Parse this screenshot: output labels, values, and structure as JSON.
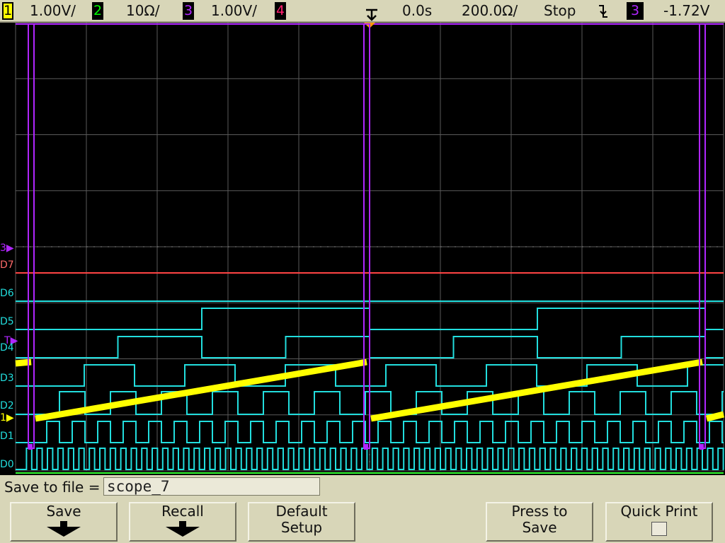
{
  "status_bar": {
    "ch1": {
      "num": "1",
      "scale": "1.00V/",
      "color": "#ffff00"
    },
    "ch2": {
      "num": "2",
      "scale": "10Ω/",
      "color": "#00ff00"
    },
    "ch3": {
      "num": "3",
      "scale": "1.00V/",
      "color": "#b026ff"
    },
    "ch4": {
      "num": "4",
      "color": "#ff1f6e"
    },
    "trigger_delay": "0.0s",
    "timebase": "200.0Ω/",
    "run_state": "Stop",
    "trigger_source": "3",
    "trigger_level": "-1.72V"
  },
  "channel_labels": {
    "ch3": "3",
    "d7": "D7",
    "d6": "D6",
    "d5": "D5",
    "t": "T",
    "d4": "D4",
    "d3": "D3",
    "d2": "D2",
    "ch1": "1",
    "d1": "D1",
    "d0": "D0"
  },
  "save_bar": {
    "label": "Save to file =",
    "filename": "scope_7"
  },
  "softkeys": {
    "save": "Save",
    "recall": "Recall",
    "default_setup_1": "Default",
    "default_setup_2": "Setup",
    "press_to_save_1": "Press to",
    "press_to_save_2": "Save",
    "quick_print": "Quick Print"
  },
  "colors": {
    "digital": "#22dede",
    "d7": "#ff4444",
    "ramp": "#ffff00",
    "ch3": "#b026ff",
    "grid": "#5a5a5a"
  }
}
